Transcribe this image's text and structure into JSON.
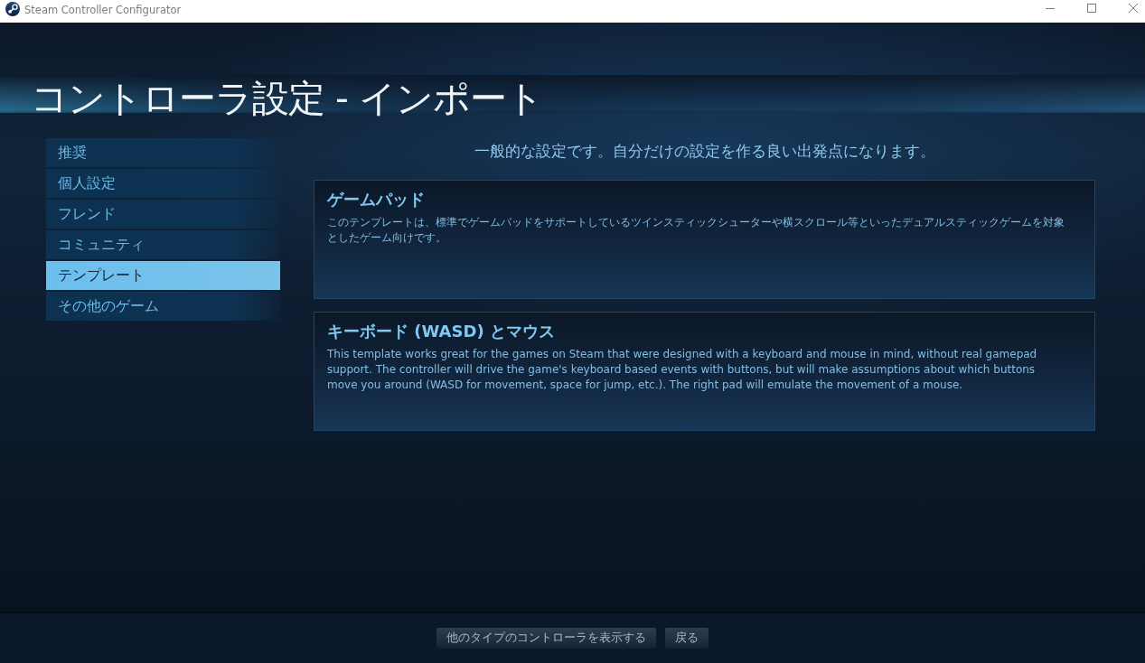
{
  "window": {
    "title": "Steam Controller Configurator"
  },
  "heading": "コントローラ設定 - インポート",
  "sidebar": {
    "items": [
      {
        "label": "推奨",
        "selected": false
      },
      {
        "label": "個人設定",
        "selected": false
      },
      {
        "label": "フレンド",
        "selected": false
      },
      {
        "label": "コミュニティ",
        "selected": false
      },
      {
        "label": "テンプレート",
        "selected": true
      },
      {
        "label": "その他のゲーム",
        "selected": false
      }
    ]
  },
  "subtitle": "一般的な設定です。自分だけの設定を作る良い出発点になります。",
  "templates": [
    {
      "title": "ゲームパッド",
      "description": "このテンプレートは、標準でゲームパッドをサポートしているツインスティックシューターや横スクロール等といったデュアルスティックゲームを対象としたゲーム向けです。"
    },
    {
      "title": "キーボード (WASD) とマウス",
      "description": "This template works great for the games on Steam that were designed with a keyboard and mouse in mind, without real gamepad support. The controller will drive the game's keyboard based events with buttons, but will make assumptions about which buttons move you around (WASD for movement, space for jump, etc.). The right pad will emulate the movement of a mouse."
    }
  ],
  "footer": {
    "buttons": [
      "他のタイプのコントローラを表示する",
      "戻る"
    ]
  }
}
